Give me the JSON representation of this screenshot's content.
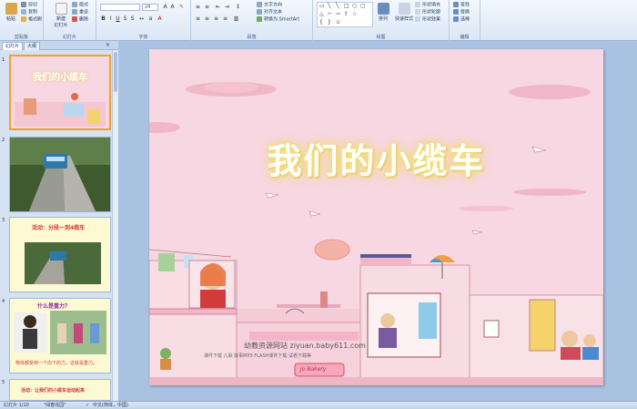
{
  "ribbon": {
    "clipboard": {
      "paste": "粘贴",
      "cut": "剪切",
      "copy": "复制",
      "format_painter": "格式刷",
      "label": "剪贴板"
    },
    "slides": {
      "new_slide": "新建",
      "new_slide2": "幻灯片",
      "layout": "版式",
      "reset": "重设",
      "delete": "删除",
      "label": "幻灯片"
    },
    "font": {
      "font_name": "",
      "font_size": "24",
      "label": "字体"
    },
    "paragraph": {
      "text_direction": "文字方向",
      "align_text": "对齐文本",
      "convert_smartart": "转换为 SmartArt",
      "label": "段落"
    },
    "drawing": {
      "arrange": "排列",
      "quick_styles": "快速样式",
      "shape_fill": "形状填充",
      "shape_outline": "形状轮廓",
      "shape_effects": "形状效果",
      "label": "绘图"
    },
    "editing": {
      "find": "查找",
      "replace": "替换",
      "select": "选择",
      "label": "编辑"
    }
  },
  "left_panel": {
    "tab_slides": "幻灯片",
    "tab_outline": "大纲",
    "thumbnails": [
      {
        "num": "1",
        "title": "我们的小缆车"
      },
      {
        "num": "2",
        "title": ""
      },
      {
        "num": "3",
        "title": "活动：分段一到4缆车"
      },
      {
        "num": "4",
        "title": "什么是重力？",
        "caption": "物体都受到一个向下的力，这就是重力。"
      },
      {
        "num": "5",
        "title": "活动：让我们的小缆车运动起来"
      }
    ]
  },
  "slide": {
    "title": "我们的小缆车",
    "watermark_line1": "幼教资源网站  ziyuan.baby611.com",
    "watermark_line2": "课件下载    儿歌    故事MP3    FLASH课件下载    试卷下载等",
    "shop_sign": "Jo Bakery"
  },
  "status": {
    "slide_counter": "幻灯片 1/10",
    "theme": "\"绿春花园\"",
    "language": "中文(简体，中国)"
  },
  "colors": {
    "ribbon_bg": "#dbe7f5",
    "slide_bg": "#f7d7e1",
    "title_color": "#ffffff",
    "title_glow": "#f4e27a"
  }
}
